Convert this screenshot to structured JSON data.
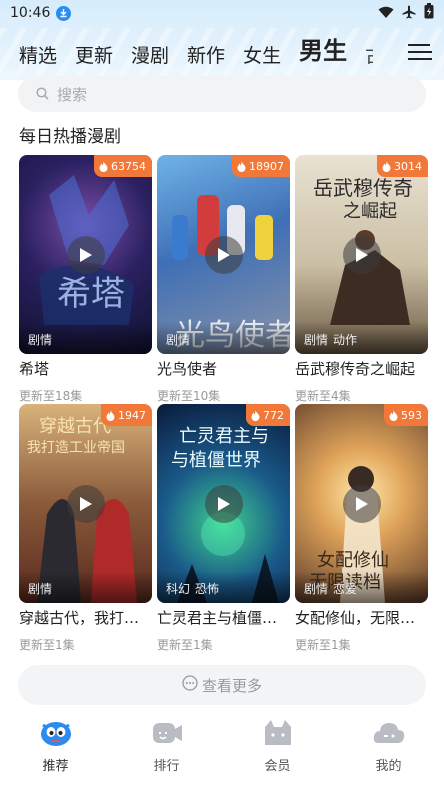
{
  "status": {
    "time": "10:46"
  },
  "tabs": [
    {
      "label": "精选",
      "active": false
    },
    {
      "label": "更新",
      "active": false
    },
    {
      "label": "漫剧",
      "active": false
    },
    {
      "label": "新作",
      "active": false
    },
    {
      "label": "女生",
      "active": false
    },
    {
      "label": "男生",
      "active": true
    }
  ],
  "search": {
    "placeholder": "搜索"
  },
  "section": {
    "title": "每日热播漫剧"
  },
  "cards": [
    {
      "heat": "63754",
      "tags": [
        "剧情"
      ],
      "title": "希塔",
      "update": "更新至18集"
    },
    {
      "heat": "18907",
      "tags": [
        "剧情"
      ],
      "title": "光鸟使者",
      "update": "更新至10集"
    },
    {
      "heat": "3014",
      "tags": [
        "剧情",
        "动作"
      ],
      "title": "岳武穆传奇之崛起",
      "update": "更新至4集"
    },
    {
      "heat": "1947",
      "tags": [
        "剧情"
      ],
      "title": "穿越古代，我打造工业帝国",
      "update": "更新至1集"
    },
    {
      "heat": "772",
      "tags": [
        "科幻",
        "恐怖"
      ],
      "title": "亡灵君主与植僵世界",
      "update": "更新至1集"
    },
    {
      "heat": "593",
      "tags": [
        "剧情",
        "恋爱"
      ],
      "title": "女配修仙，无限读档",
      "update": "更新至1集"
    }
  ],
  "more": {
    "label": "查看更多"
  },
  "bottom_nav": [
    {
      "label": "推荐",
      "icon": "recommend-mascot-icon",
      "active": true
    },
    {
      "label": "排行",
      "icon": "ranking-icon",
      "active": false
    },
    {
      "label": "会员",
      "icon": "member-cat-icon",
      "active": false
    },
    {
      "label": "我的",
      "icon": "profile-cloud-icon",
      "active": false
    }
  ],
  "colors": {
    "accent": "#2a8cf0",
    "heat_badge": "#f2783a"
  }
}
